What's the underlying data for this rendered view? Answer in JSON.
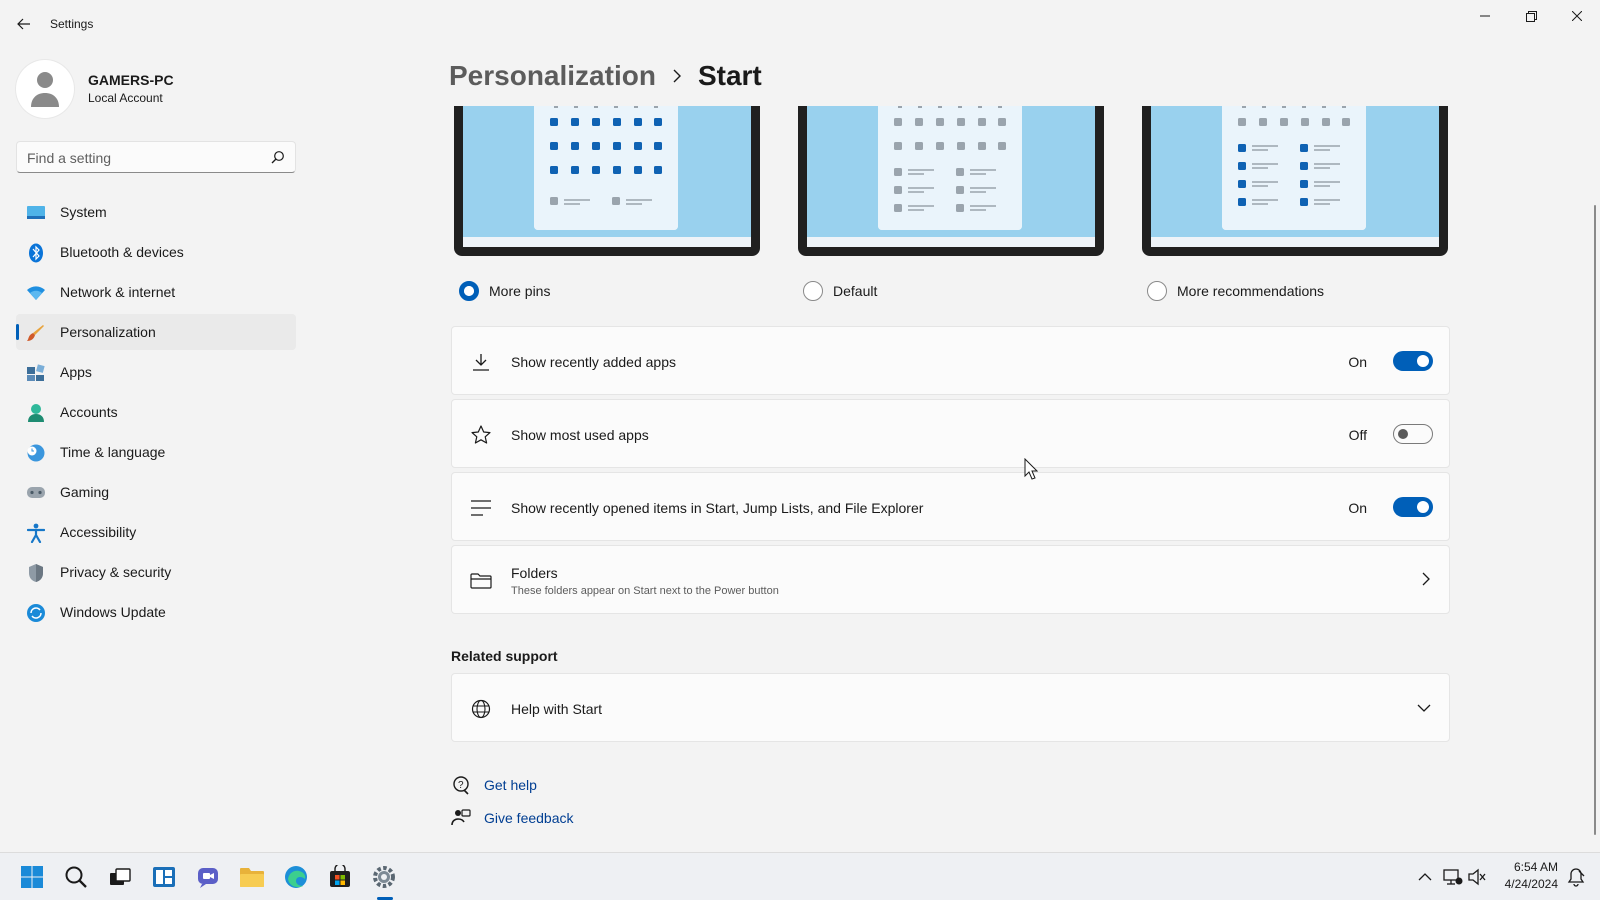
{
  "window": {
    "title": "Settings",
    "controls": [
      "minimize",
      "maximize",
      "close"
    ]
  },
  "profile": {
    "name": "GAMERS-PC",
    "account_type": "Local Account"
  },
  "search": {
    "placeholder": "Find a setting"
  },
  "sidebar": {
    "items": [
      {
        "label": "System",
        "icon": "system-icon",
        "active": false
      },
      {
        "label": "Bluetooth & devices",
        "icon": "bluetooth-icon",
        "active": false
      },
      {
        "label": "Network & internet",
        "icon": "wifi-icon",
        "active": false
      },
      {
        "label": "Personalization",
        "icon": "brush-icon",
        "active": true
      },
      {
        "label": "Apps",
        "icon": "apps-icon",
        "active": false
      },
      {
        "label": "Accounts",
        "icon": "accounts-icon",
        "active": false
      },
      {
        "label": "Time & language",
        "icon": "time-language-icon",
        "active": false
      },
      {
        "label": "Gaming",
        "icon": "gamepad-icon",
        "active": false
      },
      {
        "label": "Accessibility",
        "icon": "accessibility-icon",
        "active": false
      },
      {
        "label": "Privacy & security",
        "icon": "shield-icon",
        "active": false
      },
      {
        "label": "Windows Update",
        "icon": "windows-update-icon",
        "active": false
      }
    ]
  },
  "breadcrumb": {
    "parent": "Personalization",
    "current": "Start"
  },
  "layout_options": [
    {
      "label": "More pins",
      "selected": true
    },
    {
      "label": "Default",
      "selected": false
    },
    {
      "label": "More recommendations",
      "selected": false
    }
  ],
  "settings": [
    {
      "label": "Show recently added apps",
      "icon": "download-icon",
      "state": "On",
      "on": true
    },
    {
      "label": "Show most used apps",
      "icon": "star-icon",
      "state": "Off",
      "on": false
    },
    {
      "label": "Show recently opened items in Start, Jump Lists, and File Explorer",
      "icon": "list-icon",
      "state": "On",
      "on": true
    }
  ],
  "folders": {
    "label": "Folders",
    "description": "These folders appear on Start next to the Power button"
  },
  "related_support": {
    "title": "Related support",
    "help_item": "Help with Start"
  },
  "links": {
    "get_help": "Get help",
    "give_feedback": "Give feedback"
  },
  "taskbar": {
    "apps": [
      "start-icon",
      "search-icon",
      "task-view-icon",
      "widgets-icon",
      "chat-icon",
      "file-explorer-icon",
      "edge-icon",
      "store-icon",
      "settings-icon"
    ],
    "time": "6:54 AM",
    "date": "4/24/2024"
  },
  "colors": {
    "accent": "#005fb8",
    "background": "#f3f3f3",
    "card": "#fbfbfb",
    "link": "#003e92"
  }
}
